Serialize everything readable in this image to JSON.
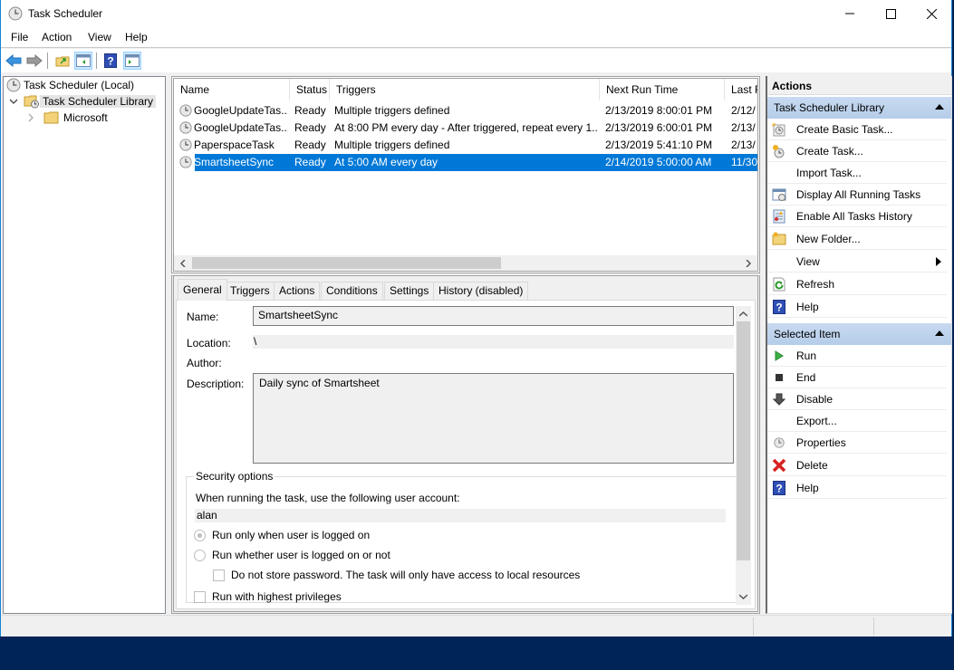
{
  "window": {
    "title": "Task Scheduler",
    "controls": {
      "minimize": "minimize",
      "maximize": "maximize",
      "close": "close"
    }
  },
  "menu": [
    "File",
    "Action",
    "View",
    "Help"
  ],
  "toolbar": {
    "buttons": [
      "back-arrow",
      "forward-arrow",
      "up-folder",
      "show-hide-console-tree",
      "help",
      "show-hide-action-pane"
    ]
  },
  "tree": {
    "root": "Task Scheduler (Local)",
    "library": "Task Scheduler Library",
    "child": "Microsoft"
  },
  "task_list": {
    "columns": [
      "Name",
      "Status",
      "Triggers",
      "Next Run Time",
      "Last R"
    ],
    "rows": [
      {
        "name": "GoogleUpdateTas...",
        "status": "Ready",
        "triggers": "Multiple triggers defined",
        "next_run": "2/13/2019 8:00:01 PM",
        "last_run": "2/12/"
      },
      {
        "name": "GoogleUpdateTas...",
        "status": "Ready",
        "triggers": "At 8:00 PM every day - After triggered, repeat every 1...",
        "next_run": "2/13/2019 6:00:01 PM",
        "last_run": "2/13/"
      },
      {
        "name": "PaperspaceTask",
        "status": "Ready",
        "triggers": "Multiple triggers defined",
        "next_run": "2/13/2019 5:41:10 PM",
        "last_run": "2/13/"
      },
      {
        "name": "SmartsheetSync",
        "status": "Ready",
        "triggers": "At 5:00 AM every day",
        "next_run": "2/14/2019 5:00:00 AM",
        "last_run": "11/30",
        "selected": true
      }
    ]
  },
  "details": {
    "tabs": [
      "General",
      "Triggers",
      "Actions",
      "Conditions",
      "Settings",
      "History (disabled)"
    ],
    "active_tab": "General",
    "name_label": "Name:",
    "name_value": "SmartsheetSync",
    "location_label": "Location:",
    "location_value": "\\",
    "author_label": "Author:",
    "author_value": "",
    "description_label": "Description:",
    "description_value": "Daily sync of Smartsheet",
    "security": {
      "legend": "Security options",
      "account_prompt": "When running the task, use the following user account:",
      "account": "alan",
      "radio_logged_on": "Run only when user is logged on",
      "radio_logged_on_checked": true,
      "radio_whether": "Run whether user is logged on or not",
      "radio_whether_checked": false,
      "no_store_password": "Do not store password.  The task will only have access to local resources",
      "no_store_password_checked": false,
      "highest_privileges": "Run with highest privileges",
      "highest_privileges_checked": false
    }
  },
  "actions_pane": {
    "title": "Actions",
    "group1": {
      "title": "Task Scheduler Library",
      "items": [
        "Create Basic Task...",
        "Create Task...",
        "Import Task...",
        "Display All Running Tasks",
        "Enable All Tasks History",
        "New Folder...",
        "View",
        "Refresh",
        "Help"
      ]
    },
    "group2": {
      "title": "Selected Item",
      "items": [
        "Run",
        "End",
        "Disable",
        "Export...",
        "Properties",
        "Delete",
        "Help"
      ]
    }
  },
  "colors": {
    "selection": "#0078d7",
    "group_header": "#c8daf0",
    "taskbar": "#002457",
    "window_border": "#1883d7"
  }
}
